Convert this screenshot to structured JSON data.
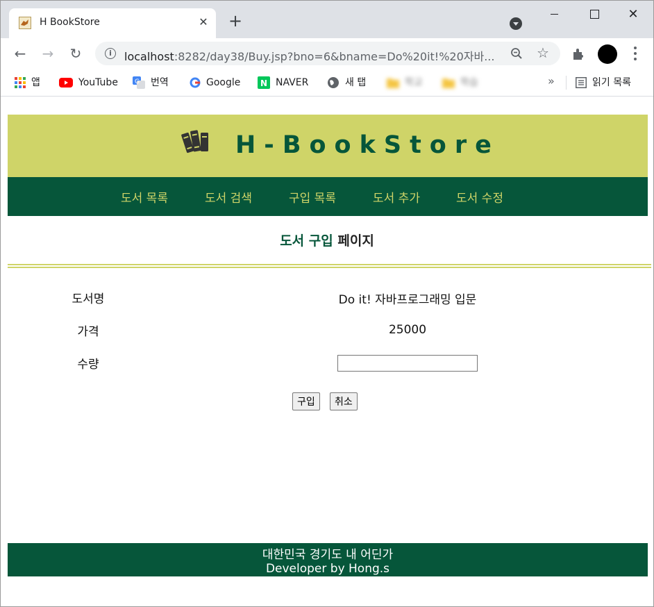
{
  "browser": {
    "tab_title": "H BookStore",
    "url_host": "localhost",
    "url_rest": ":8282/day38/Buy.jsp?bno=6&bname=Do%20it!%20자바...",
    "bookmarks": [
      {
        "label": "앱"
      },
      {
        "label": "YouTube"
      },
      {
        "label": "번역"
      },
      {
        "label": "Google"
      },
      {
        "label": "NAVER"
      },
      {
        "label": "새 탭"
      },
      {
        "label": "학교"
      },
      {
        "label": "학습"
      }
    ],
    "more_bookmarks": "»",
    "reading_list": "읽기 목록"
  },
  "site": {
    "title": "H-BookStore",
    "nav": [
      {
        "label": "도서 목록"
      },
      {
        "label": "도서 검색"
      },
      {
        "label": "구입 목록"
      },
      {
        "label": "도서 추가"
      },
      {
        "label": "도서 수정"
      }
    ],
    "heading_part1": "도서 구입",
    "heading_part2": "페이지",
    "form": {
      "book_name_label": "도서명",
      "book_name_value": "Do it! 자바프로그래밍 입문",
      "price_label": "가격",
      "price_value": "25000",
      "quantity_label": "수량",
      "quantity_value": "",
      "buy_button": "구입",
      "cancel_button": "취소"
    },
    "footer": {
      "line1": "대한민국 경기도 내 어딘가",
      "line2": "Developer by Hong.s"
    }
  },
  "colors": {
    "header_bg": "#cfd468",
    "nav_bg": "#06563a",
    "nav_text": "#cfd468",
    "title_text": "#06563a"
  }
}
